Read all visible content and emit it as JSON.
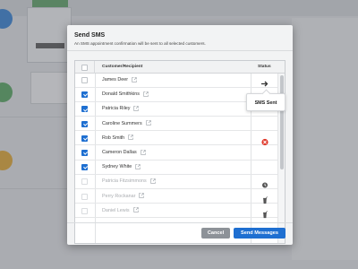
{
  "modal": {
    "title": "Send SMS",
    "description": "An SMS appointment confirmation will be sent to all selected customers."
  },
  "table": {
    "col_recipient": "Customer/Recipient",
    "col_status": "Status",
    "rows": [
      {
        "name": "James Deer",
        "checked": false,
        "dim": false,
        "status": "sent"
      },
      {
        "name": "Donald Smithkins",
        "checked": true,
        "dim": false,
        "status": ""
      },
      {
        "name": "Patricia Riley",
        "checked": true,
        "dim": false,
        "status": ""
      },
      {
        "name": "Caroline Summers",
        "checked": true,
        "dim": false,
        "status": ""
      },
      {
        "name": "Rob Smith",
        "checked": true,
        "dim": false,
        "status": "error"
      },
      {
        "name": "Cameron Dallas",
        "checked": true,
        "dim": false,
        "status": ""
      },
      {
        "name": "Sydney White",
        "checked": true,
        "dim": false,
        "status": ""
      },
      {
        "name": "Patricia Fitzsimmons",
        "checked": false,
        "dim": true,
        "status": "pending"
      },
      {
        "name": "Perry Rockanar",
        "checked": false,
        "dim": true,
        "status": "trash"
      },
      {
        "name": "Daniel Lewis",
        "checked": false,
        "dim": true,
        "status": "trash"
      }
    ]
  },
  "tooltip": {
    "text": "SMS Sent"
  },
  "buttons": {
    "cancel": "Cancel",
    "send": "Send Messages"
  },
  "colors": {
    "accent": "#1e6fd1",
    "error": "#e0392b"
  },
  "icons": {
    "row_link": "external-link-icon",
    "sent": "sent-arrow-icon",
    "error": "error-x-icon",
    "pending": "pending-clock-icon",
    "trash": "trash-icon"
  }
}
